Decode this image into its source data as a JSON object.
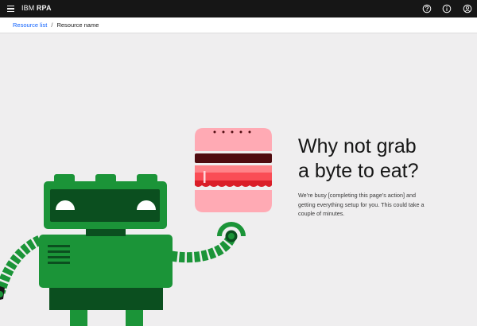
{
  "header": {
    "brand_prefix": "IBM",
    "brand_product": "RPA",
    "icons": [
      "menu-icon",
      "help-icon",
      "info-icon",
      "user-icon"
    ]
  },
  "breadcrumb": {
    "parent": "Resource list",
    "separator": "/",
    "current": "Resource name"
  },
  "main": {
    "headline_line1": "Why not grab",
    "headline_line2": "a byte to eat?",
    "message": "We’re busy [completing this page’s action] and getting everything setup for you. This could take a couple of minutes."
  },
  "colors": {
    "topbar": "#161616",
    "link": "#0f62fe",
    "robot_green": "#1b9438",
    "robot_dark": "#0b4f1f",
    "burger_pink": "#ffaab4",
    "burger_red": "#da1e28",
    "burger_patty": "#4f0b0f"
  }
}
